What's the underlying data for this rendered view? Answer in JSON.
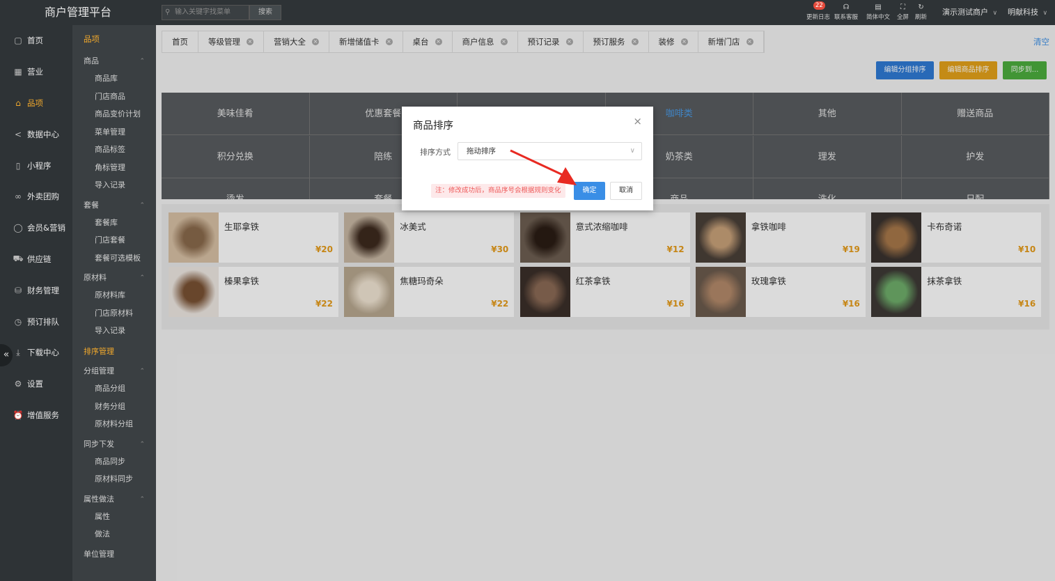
{
  "brand": "商户管理平台",
  "nav": [
    {
      "label": "首页",
      "icon": "home-icon",
      "glyph": "▢"
    },
    {
      "label": "营业",
      "icon": "calendar-icon",
      "glyph": "▦"
    },
    {
      "label": "品项",
      "icon": "bag-icon",
      "glyph": "⌂",
      "active": true
    },
    {
      "label": "数据中心",
      "icon": "share-icon",
      "glyph": "<"
    },
    {
      "label": "小程序",
      "icon": "phone-icon",
      "glyph": "▯"
    },
    {
      "label": "外卖团购",
      "icon": "users-icon",
      "glyph": "∞"
    },
    {
      "label": "会员&营销",
      "icon": "user-icon",
      "glyph": "◯"
    },
    {
      "label": "供应链",
      "icon": "truck-icon",
      "glyph": "⛟"
    },
    {
      "label": "财务管理",
      "icon": "database-icon",
      "glyph": "⛁"
    },
    {
      "label": "预订排队",
      "icon": "clock-icon",
      "glyph": "◷"
    },
    {
      "label": "下载中心",
      "icon": "download-icon",
      "glyph": "⤓"
    },
    {
      "label": "设置",
      "icon": "gear-icon",
      "glyph": "⚙"
    },
    {
      "label": "增值服务",
      "icon": "alarm-icon",
      "glyph": "⏰"
    }
  ],
  "subnav": {
    "title": "品项",
    "groups": [
      {
        "label": "商品",
        "items": [
          "商品库",
          "门店商品",
          "商品变价计划",
          "菜单管理",
          "商品标签",
          "角标管理",
          "导入记录"
        ]
      },
      {
        "label": "套餐",
        "items": [
          "套餐库",
          "门店套餐",
          "套餐可选模板"
        ]
      },
      {
        "label": "原材料",
        "items": [
          "原材料库",
          "门店原材料",
          "导入记录"
        ]
      }
    ],
    "highlight": "排序管理",
    "groups2": [
      {
        "label": "分组管理",
        "items": [
          "商品分组",
          "财务分组",
          "原材料分组"
        ]
      },
      {
        "label": "同步下发",
        "items": [
          "商品同步",
          "原材料同步"
        ]
      },
      {
        "label": "属性做法",
        "items": [
          "属性",
          "做法"
        ]
      }
    ],
    "tail": "单位管理"
  },
  "topbar": {
    "search_placeholder": "输入关键字找菜单",
    "search_button": "搜索",
    "tools": [
      {
        "label": "更新日志",
        "icon": "bell-icon",
        "glyph": "♫",
        "badge": "22"
      },
      {
        "label": "联系客服",
        "icon": "headset-icon",
        "glyph": "☊"
      },
      {
        "label": "简体中文",
        "icon": "language-icon",
        "glyph": "▤"
      },
      {
        "label": "全屏",
        "icon": "fullscreen-icon",
        "glyph": "⛶"
      },
      {
        "label": "刷新",
        "icon": "refresh-icon",
        "glyph": "↻"
      }
    ],
    "merchant": "演示测试商户",
    "company": "明献科技"
  },
  "tabs": [
    "首页",
    "等级管理",
    "营销大全",
    "新增储值卡",
    "桌台",
    "商户信息",
    "预订记录",
    "预订服务",
    "装修",
    "新增门店"
  ],
  "clear_label": "清空",
  "actions": [
    {
      "label": "编辑分组排序",
      "color": "#2f7bd6"
    },
    {
      "label": "编辑商品排序",
      "color": "#e5a21a"
    },
    {
      "label": "同步到...",
      "color": "#4cae3e"
    }
  ],
  "categories": [
    [
      "美味佳肴",
      "优惠套餐",
      "",
      "咖啡类",
      "其他",
      "赠送商品"
    ],
    [
      "积分兑换",
      "陪练",
      "",
      "奶茶类",
      "理发",
      "护发"
    ],
    [
      "烫发",
      "套餐",
      "",
      "商品",
      "洗化",
      "日配"
    ]
  ],
  "selected_category": "咖啡类",
  "products": [
    {
      "name": "生耶拿铁",
      "price": "¥20",
      "c1": "#d9c2a6",
      "c2": "#8a6a4c"
    },
    {
      "name": "冰美式",
      "price": "¥30",
      "c1": "#c9b9a5",
      "c2": "#3d2a1e"
    },
    {
      "name": "意式浓缩咖啡",
      "price": "¥12",
      "c1": "#6e5f52",
      "c2": "#2a1c14"
    },
    {
      "name": "拿铁咖啡",
      "price": "¥19",
      "c1": "#4a4038",
      "c2": "#c9a27a"
    },
    {
      "name": "卡布奇诺",
      "price": "¥10",
      "c1": "#3a332f",
      "c2": "#a8784a"
    },
    {
      "name": "榛果拿铁",
      "price": "¥22",
      "c1": "#efe9e3",
      "c2": "#7a5234"
    },
    {
      "name": "焦糖玛奇朵",
      "price": "¥22",
      "c1": "#b8a890",
      "c2": "#f2e6d4"
    },
    {
      "name": "红茶拿铁",
      "price": "¥16",
      "c1": "#3b2f29",
      "c2": "#8b6a55"
    },
    {
      "name": "玫瑰拿铁",
      "price": "¥16",
      "c1": "#6c5b4d",
      "c2": "#b48a6a"
    },
    {
      "name": "抹茶拿铁",
      "price": "¥16",
      "c1": "#3e3a36",
      "c2": "#6fae6b"
    }
  ],
  "modal": {
    "title": "商品排序",
    "close_glyph": "×",
    "sort_label": "排序方式",
    "sort_value": "拖动排序",
    "note": "注：修改成功后，商品序号会根据规则变化",
    "ok": "确定",
    "cancel": "取消"
  },
  "collapse_glyph": "«",
  "chevron_glyph": "⌃",
  "dropdown_glyph": "∨",
  "tab_close_glyph": "×",
  "search_glyph": "⚲",
  "account_chevron": "∨",
  "arrow_color": "#e82a22"
}
